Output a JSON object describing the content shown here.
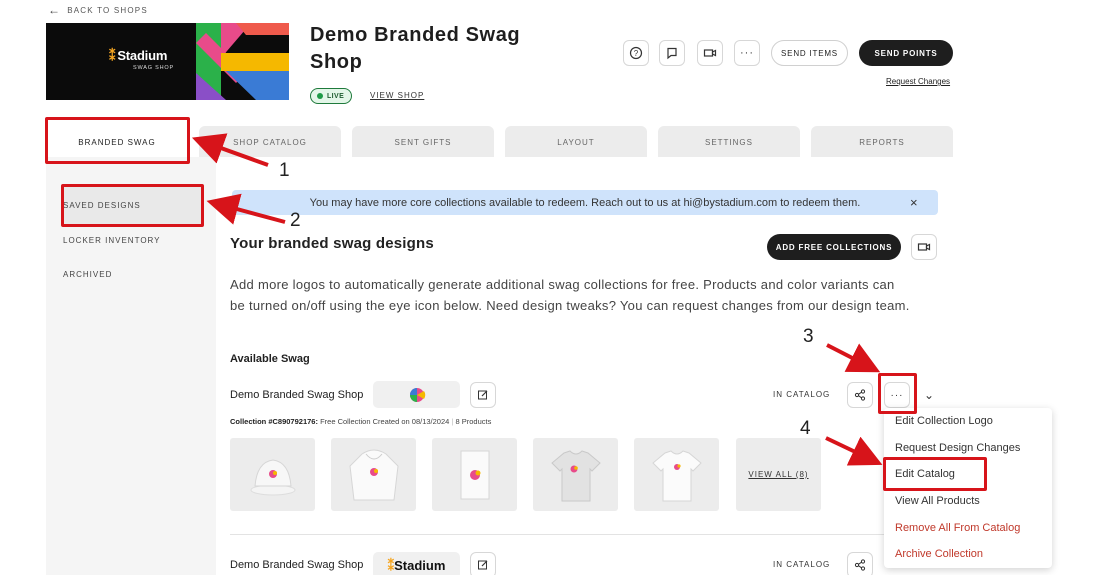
{
  "header": {
    "back_label": "BACK TO SHOPS",
    "shop_title": "Demo Branded Swag Shop",
    "banner_logo": "Stadium",
    "banner_sub": "SWAG SHOP",
    "status_badge": "LIVE",
    "view_shop": "VIEW SHOP",
    "send_items": "SEND ITEMS",
    "send_points": "SEND POINTS",
    "request_changes": "Request Changes"
  },
  "tabs": [
    {
      "label": "BRANDED SWAG",
      "active": true
    },
    {
      "label": "SHOP CATALOG"
    },
    {
      "label": "SENT GIFTS"
    },
    {
      "label": "LAYOUT"
    },
    {
      "label": "SETTINGS"
    },
    {
      "label": "REPORTS"
    }
  ],
  "sidebar": {
    "items": [
      {
        "label": "SAVED DESIGNS",
        "active": true
      },
      {
        "label": "LOCKER INVENTORY"
      },
      {
        "label": "ARCHIVED"
      }
    ]
  },
  "main": {
    "alert": "You may have more core collections available to redeem. Reach out to us at hi@bystadium.com to redeem them.",
    "alert_close": "×",
    "heading": "Your branded swag designs",
    "add_free_collections": "ADD FREE COLLECTIONS",
    "description": "Add more logos to automatically generate additional swag collections for free. Products and color variants can be turned on/off using the eye icon below. Need design tweaks? You can request changes from our design team.",
    "available_label": "Available Swag",
    "collections": [
      {
        "name": "Demo Branded Swag Shop",
        "status": "IN CATALOG",
        "collection_id": "Collection #C890792176:",
        "created": "Free Collection Created on 08/13/2024",
        "count": "8 Products",
        "view_all": "VIEW ALL (8)"
      },
      {
        "name": "Demo Branded Swag Shop",
        "status": "IN CATALOG",
        "logo_text": "Stadium"
      }
    ]
  },
  "menu": {
    "items": [
      {
        "label": "Edit Collection Logo"
      },
      {
        "label": "Request Design Changes"
      },
      {
        "label": "Edit Catalog"
      },
      {
        "label": "View All Products"
      },
      {
        "label": "Remove All From Catalog",
        "danger": true
      },
      {
        "label": "Archive Collection",
        "danger": true
      }
    ]
  },
  "annotations": {
    "labels": [
      "1",
      "2",
      "3",
      "4"
    ],
    "color": "#d7141a"
  },
  "colors": {
    "primary_dark": "#1e1e1e",
    "live_green": "#1f9a47",
    "alert_blue": "#cfe3fb",
    "danger": "#c0392b"
  }
}
